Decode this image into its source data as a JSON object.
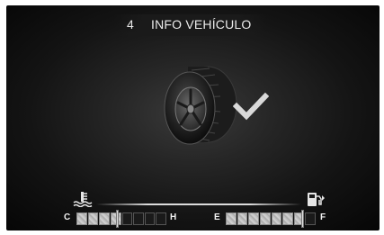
{
  "header": {
    "number": "4",
    "title": "INFO VEHÍCULO"
  },
  "status": {
    "tire_check": "ok"
  },
  "gauges": {
    "temperature": {
      "low_label": "C",
      "high_label": "H",
      "level": 0.45,
      "segments": 8,
      "filled": 4
    },
    "fuel": {
      "low_label": "E",
      "high_label": "F",
      "level": 0.85,
      "segments": 8,
      "filled": 7
    }
  },
  "icons": {
    "temperature": "coolant-temperature-icon",
    "fuel": "fuel-pump-icon",
    "tire": "tire-icon",
    "check": "checkmark-icon"
  },
  "colors": {
    "background": "#141414",
    "text": "#ececec",
    "gauge_fill": "#c4c4c4"
  }
}
